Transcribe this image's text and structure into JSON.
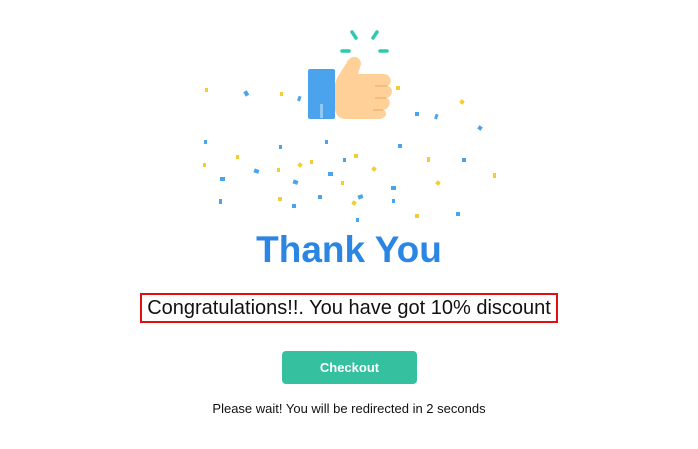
{
  "illustration": {
    "icon": "thumbs-up-confetti-icon",
    "colors": {
      "sleeve": "#4aa3ec",
      "hand": "#ffd199",
      "burst": "#2fc9b0",
      "confetti_blue": "#4aa3ec",
      "confetti_yellow": "#f5cd2e"
    }
  },
  "title": "Thank You",
  "message": "Congratulations!!. You have got 10% discount",
  "checkout_label": "Checkout",
  "redirect_text": "Please wait! You will be redirected in 2 seconds",
  "colors": {
    "title": "#2b86e3",
    "button": "#35c0a0",
    "highlight_border": "#e01010"
  }
}
